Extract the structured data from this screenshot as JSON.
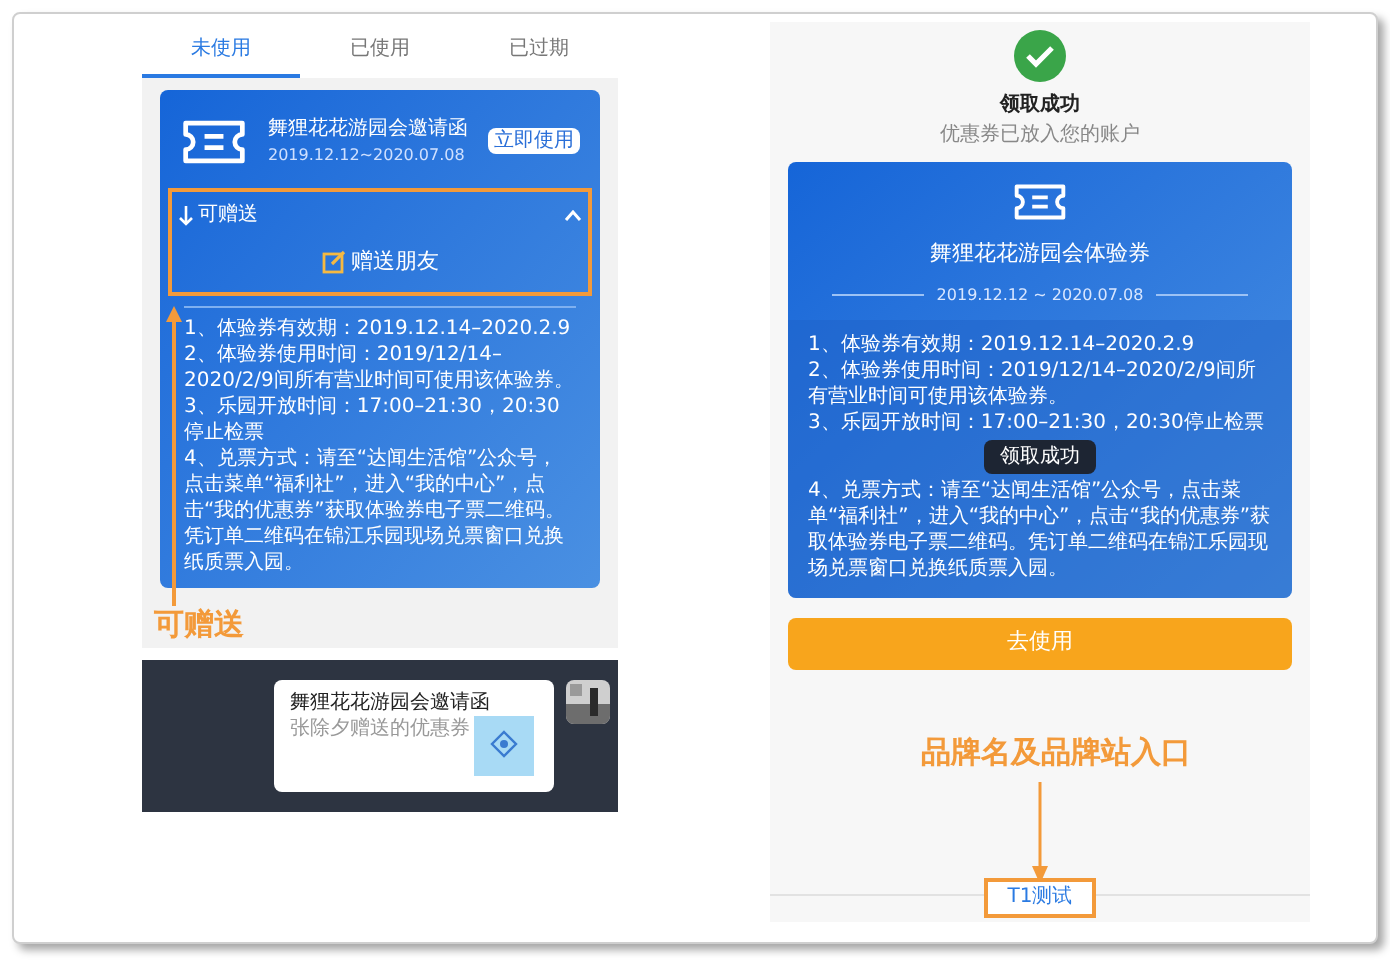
{
  "left_screen": {
    "tabs": [
      {
        "label": "未使用",
        "selected": true
      },
      {
        "label": "已使用",
        "selected": false
      },
      {
        "label": "已过期",
        "selected": false
      }
    ],
    "coupon": {
      "title": "舞狸花花游园会邀请函",
      "dates": "2019.12.12~2020.07.08",
      "use_button": "立即使用",
      "gift_toggle": "可赠送",
      "expanded": true,
      "gift_button": "赠送朋友",
      "rules": [
        "1、体验券有效期：2019.12.14–2020.2.9",
        "2、体验券使用时间：2019/12/14–2020/2/9间所有营业时间可使用该体验券。",
        "3、乐园开放时间：17:00–21:30，20:30停止检票",
        "4、兑票方式：请至“达闻生活馆”公众号，点击菜单“福利社”，进入“我的中心”，点击“我的优惠券”获取体验券电子票二维码。凭订单二维码在锦江乐园现场兑票窗口兑换纸质票入园。"
      ]
    }
  },
  "left_annotation": "可赠送",
  "chat_message": {
    "title": "舞狸花花游园会邀请函",
    "subtitle": "张除夕赠送的优惠券"
  },
  "right_screen": {
    "status_title": "领取成功",
    "status_subtitle": "优惠券已放入您的账户",
    "coupon": {
      "title": "舞狸花花游园会体验券",
      "dates": "2019.12.12 ~ 2020.07.08",
      "rules": [
        "1、体验券有效期：2019.12.14–2020.2.9",
        "2、体验券使用时间：2019/12/14–2020/2/9间所有营业时间可使用该体验券。",
        "3、乐园开放时间：17:00–21:30，20:30停止检票",
        "4、兑票方式：请至“达闻生活馆”公众号，点击菜单“福利社”，进入“我的中心”，点击“我的优惠券”获取体验券电子票二维码。凭订单二维码在锦江乐园现场兑票窗口兑换纸质票入园。"
      ]
    },
    "toast": "领取成功",
    "use_button": "去使用",
    "brand_link": "T1测试"
  },
  "right_annotation": "品牌名及品牌站入口"
}
